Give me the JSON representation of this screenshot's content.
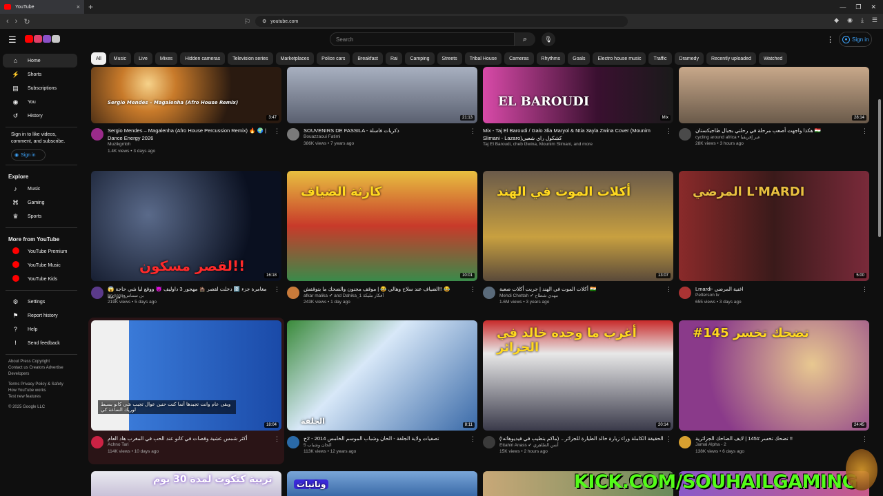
{
  "browser": {
    "tab_title": "YouTube",
    "tab_close": "×",
    "new_tab": "+",
    "url": "youtube.com"
  },
  "header": {
    "search_placeholder": "Search",
    "sign_in": "Sign in"
  },
  "chips": [
    "All",
    "Music",
    "Live",
    "Mixes",
    "Hidden cameras",
    "Television series",
    "Marketplaces",
    "Police cars",
    "Breakfast",
    "Rai",
    "Camping",
    "Streets",
    "Tribal House",
    "Cameras",
    "Rhythms",
    "Goals",
    "Electro house music",
    "Traffic",
    "Dramedy",
    "Recently uploaded",
    "Watched"
  ],
  "sidebar": {
    "main": [
      {
        "label": "Home",
        "icon": "home-icon"
      },
      {
        "label": "Shorts",
        "icon": "shorts-icon"
      },
      {
        "label": "Subscriptions",
        "icon": "subscriptions-icon"
      },
      {
        "label": "You",
        "icon": "you-icon"
      },
      {
        "label": "History",
        "icon": "history-icon"
      }
    ],
    "signin_note": "Sign in to like videos, comment, and subscribe.",
    "signin_button": "Sign in",
    "explore_title": "Explore",
    "explore": [
      {
        "label": "Music",
        "icon": "music-icon"
      },
      {
        "label": "Gaming",
        "icon": "gaming-icon"
      },
      {
        "label": "Sports",
        "icon": "trophy-icon"
      }
    ],
    "more_title": "More from YouTube",
    "more": [
      {
        "label": "YouTube Premium"
      },
      {
        "label": "YouTube Music"
      },
      {
        "label": "YouTube Kids"
      }
    ],
    "settings": [
      {
        "label": "Settings",
        "icon": "gear-icon"
      },
      {
        "label": "Report history",
        "icon": "flag-icon"
      },
      {
        "label": "Help",
        "icon": "help-icon"
      },
      {
        "label": "Send feedback",
        "icon": "feedback-icon"
      }
    ],
    "footer1": "About  Press  Copyright",
    "footer2": "Contact us  Creators  Advertise",
    "footer3": "Developers",
    "footer4": "Terms  Privacy  Policy & Safety",
    "footer5": "How YouTube works",
    "footer6": "Test new features",
    "footer7": "© 2025 Google LLC"
  },
  "videos": [
    {
      "title": "Sergio Mendes – Magalenha (Afro House Percussion Remix) 🔥 🌍 | Dance Energy 2026",
      "channel": "Muzikgmbh",
      "views": "1.4K views • 3 days ago",
      "duration": "3:47",
      "overlay": "Sergio Mendes – Magalenha (Afro House Remix)",
      "av_color": "#9a2b8a"
    },
    {
      "title": "SOUVENIRS DE FASSILA - ذكريات فاسلة",
      "channel": "Bouazzaoui Fatimi",
      "views": "386K views • 7 years ago",
      "duration": "21:13",
      "overlay": "",
      "av_color": "#7a7a7a"
    },
    {
      "title": "Mix - Taj El Baroudi / Galo 3lia Maryol & Ntia 3ayla Zwina Cover (Mounim Slimani - Lazaro)كشكول راي شعبي",
      "channel": "Taj El Baroudi, cheb l3wina, Mounim Slimani, and more",
      "views": "",
      "duration": "Mix",
      "overlay": "EL BAROUDI",
      "av_color": ""
    },
    {
      "title": "هكذا واجهت أصعب مرحلة في رحلتي بجبال طاجيكستان 🇹🇯",
      "channel": "cycling around africa • عبر إفريقيا",
      "views": "28K views • 3 hours ago",
      "duration": "28:14",
      "overlay": "",
      "av_color": "#4a4a4a"
    },
    {
      "title": "😱 مغامرة جزء 2️⃣ دخلت لقصر 🏚️ مهجور 3 داوليف 😈 ووقع ليا شي حاجة مرعبة !!",
      "channel": "bn nsns بن نسناس",
      "views": "219K views • 5 days ago",
      "duration": "16:18",
      "overlay": "لقصر مسكون!!",
      "av_color": "#5b3a8a"
    },
    {
      "title": "الضياف عند سلاح وهالي 😂 | موقف مجنون والضحك ما يتوقفش!! 😂",
      "channel": "afkar malika ✔ and Dahika_1 أفكار مليكة",
      "views": "243K views • 1 day ago",
      "duration": "10:01",
      "overlay": "كارثة الضياف",
      "av_color": "#c87a3a"
    },
    {
      "title": "أكلات الموت في الهند | جربت أكلات صعبة 🇮🇳",
      "channel": "Mehdi Chettah ✔ مهدي شطاح",
      "views": "1.6M views • 3 years ago",
      "duration": "13:07",
      "overlay": "أكلات الموت في الهند",
      "av_color": "#5a6a7a"
    },
    {
      "title": "Lmardi- اغنية المرضي",
      "channel": "Petterson tv",
      "views": "655 views • 3 days ago",
      "duration": "5:00",
      "overlay": "المرضي L'MARDI",
      "av_color": "#a33"
    },
    {
      "title": "أكثر شمس عشية وقصات في كانو عند الحب في المغرب هاد العام",
      "channel": "Achno Tari",
      "views": "114K views • 10 days ago",
      "duration": "18:04",
      "overlay": "وبقى عام وانت تجبدها أنما كنت حنين عوال تجبب شي كانو بسيط لوريك الساعة كي",
      "av_color": "#cc2244"
    },
    {
      "title": "تصفيات ولاية الجلفة - الحان وشباب الموسم الخامس 2014 - 2ج",
      "channel": "الحان وشباب 5",
      "views": "113K views • 12 years ago",
      "duration": "8:11",
      "overlay": "الجلفة",
      "av_color": "#2a6aa8"
    },
    {
      "title": "الحقيقة الكاملة وراء زيارة خالد الطيارة للجزائر... (ماكم بتطيب في فيديوهاته!)",
      "channel": "Ettahiri Anass ✔ أنس الطاهري",
      "views": "15K views • 2 hours ago",
      "duration": "20:14",
      "overlay": "أغرب ما وجده خالد في الجزائر",
      "av_color": "#3a3a3a"
    },
    {
      "title": "تضحك تخسر #145 | لايف الضاحك الجزائرية !!",
      "channel": "Jamal Alpha - 2",
      "views": "138K views • 6 days ago",
      "duration": "24:45",
      "overlay": "#145 تضحك تخسر",
      "av_color": "#d8a030"
    }
  ],
  "row4_overlays": [
    "تربية كتكوت لمدة 30 يوم",
    "ونانيات"
  ],
  "watermark": "KICK.COM/SOUHAILGAMING",
  "colors": {
    "bg": "#0f0f0f",
    "chip": "#272727",
    "accent": "#3ea6ff",
    "red": "#ff0000",
    "kick": "#53fc18"
  }
}
